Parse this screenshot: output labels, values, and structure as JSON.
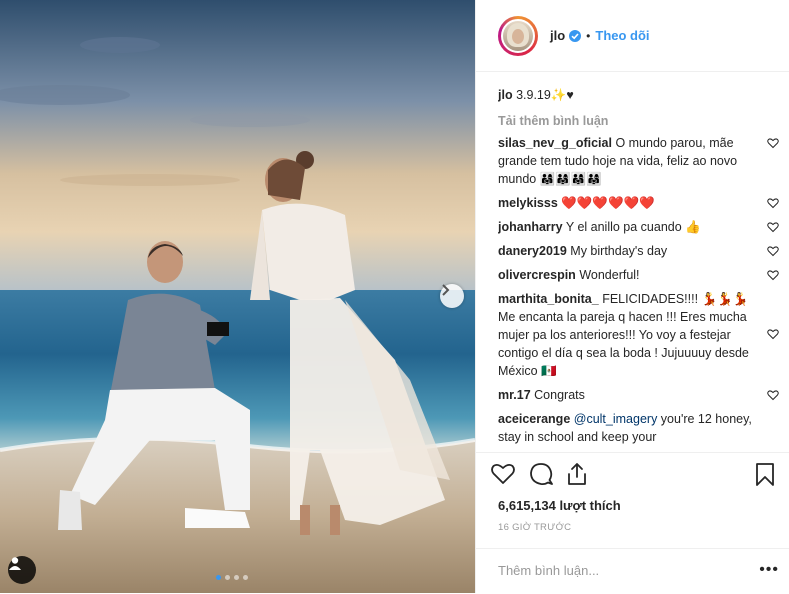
{
  "header": {
    "username": "jlo",
    "separator": "•",
    "follow_label": "Theo dõi"
  },
  "caption": {
    "username": "jlo",
    "text": "3.9.19✨♥"
  },
  "load_more_label": "Tải thêm bình luận",
  "comments": [
    {
      "user": "silas_nev_g_oficial",
      "text": "O mundo parou, mãe grande tem tudo hoje na vida, feliz ao novo mundo 👨‍👩‍👧👨‍👩‍👧👨‍👩‍👧👨‍👩‍👧"
    },
    {
      "user": "melykisss",
      "text": "❤️❤️❤️❤️❤️❤️"
    },
    {
      "user": "johanharry",
      "text": "Y el anillo pa cuando 👍"
    },
    {
      "user": "danery2019",
      "text": "My birthday's day"
    },
    {
      "user": "olivercrespin",
      "text": "Wonderful!"
    },
    {
      "user": "marthita_bonita_",
      "text": "FELICIDADES!!!! 💃💃💃 Me encanta la pareja q hacen !!! Eres mucha mujer pa los anteriores!!! Yo voy a festejar contigo el día q sea la boda ! Jujuuuuy desde México 🇲🇽"
    },
    {
      "user": "mr.17",
      "text": "Congrats"
    },
    {
      "user": "aceicerange",
      "mention": "@cult_imagery",
      "text": " you're 12 honey, stay in school and keep your"
    }
  ],
  "likes": "6,615,134 lượt thích",
  "time": "16 GIỜ TRƯỚC",
  "add_comment_placeholder": "Thêm bình luận...",
  "more_options": "•••",
  "colors": {
    "link": "#3897f0",
    "text": "#262626",
    "muted": "#999999",
    "heart_red": "#ed4956"
  },
  "carousel": {
    "total": 4,
    "active": 1
  }
}
